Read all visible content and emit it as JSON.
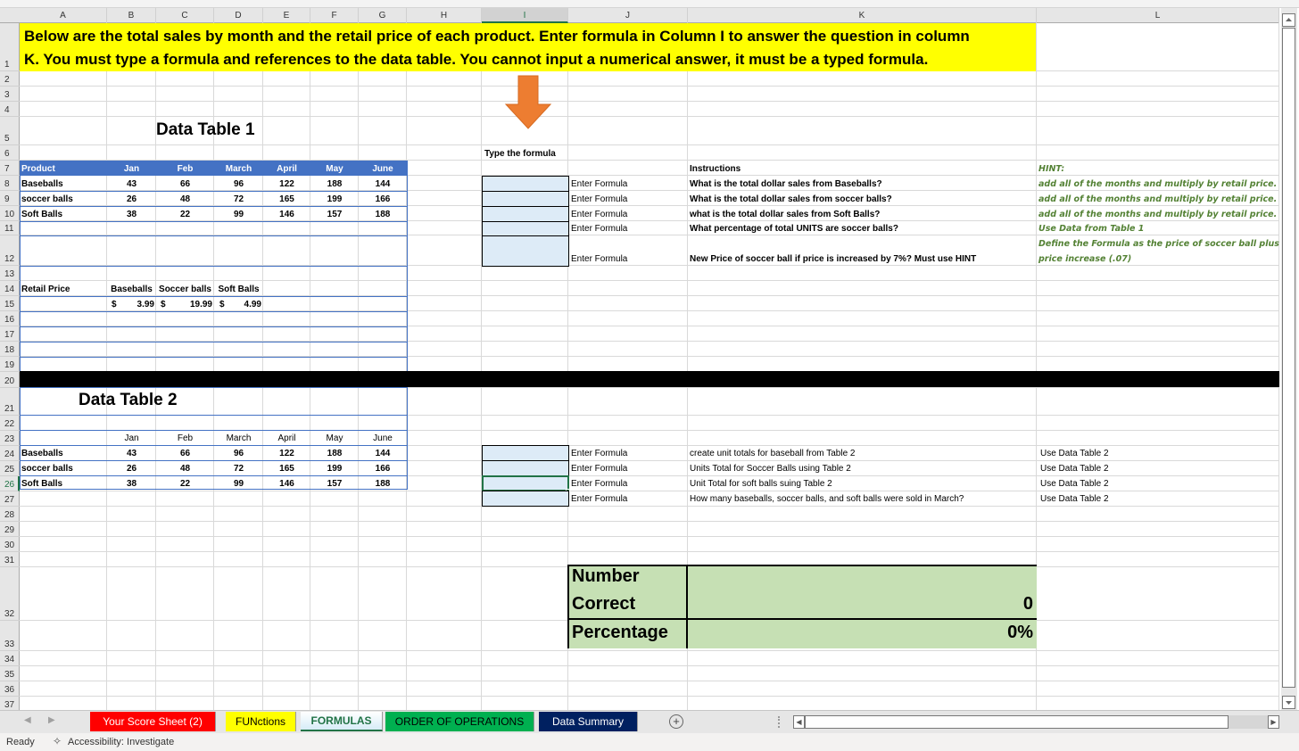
{
  "app": {
    "name": "Excel"
  },
  "columns": [
    "A",
    "B",
    "C",
    "D",
    "E",
    "F",
    "G",
    "H",
    "I",
    "J",
    "K",
    "L"
  ],
  "selected_column": "I",
  "rows": [
    "1",
    "2",
    "3",
    "4",
    "5",
    "6",
    "7",
    "8",
    "9",
    "10",
    "11",
    "12",
    "13",
    "14",
    "15",
    "16",
    "17",
    "18",
    "19",
    "20",
    "21",
    "22",
    "23",
    "24",
    "25",
    "26",
    "27",
    "28",
    "29",
    "30",
    "31",
    "32",
    "33",
    "34",
    "35",
    "36",
    "37"
  ],
  "selected_row": "26",
  "banner": {
    "line1": "Below are the total sales by month and the retail price of each product. Enter formula in Column I to answer the question in column",
    "line2": "K. You must type a formula and references to the data table. You cannot input a numerical answer, it must be a typed formula.",
    "color": "#ffff00"
  },
  "arrow": {
    "icon": "down-arrow-icon",
    "color": "#ed7d31"
  },
  "table1": {
    "title": "Data Table 1",
    "headers": [
      "Product",
      "Jan",
      "Feb",
      "March",
      "April",
      "May",
      "June"
    ],
    "rows": [
      [
        "Baseballs",
        "43",
        "66",
        "96",
        "122",
        "188",
        "144"
      ],
      [
        "soccer balls",
        "26",
        "48",
        "72",
        "165",
        "199",
        "166"
      ],
      [
        "Soft Balls",
        "38",
        "22",
        "99",
        "146",
        "157",
        "188"
      ]
    ],
    "header_color": "#4472c4"
  },
  "retail": {
    "label": "Retail Price",
    "headers": [
      "Baseballs",
      "Soccer balls",
      "Soft Balls"
    ],
    "currency": [
      "$",
      "$",
      "$"
    ],
    "values": [
      "3.99",
      "19.99",
      "4.99"
    ]
  },
  "table2": {
    "title": "Data Table 2",
    "headers": [
      "",
      "Jan",
      "Feb",
      "March",
      "April",
      "May",
      "June"
    ],
    "rows": [
      [
        "Baseballs",
        "43",
        "66",
        "96",
        "122",
        "188",
        "144"
      ],
      [
        "soccer balls",
        "26",
        "48",
        "72",
        "165",
        "199",
        "166"
      ],
      [
        "Soft Balls",
        "38",
        "22",
        "99",
        "146",
        "157",
        "188"
      ]
    ]
  },
  "questions1": {
    "type_label": "Type the formula",
    "instructions_header": "Instructions",
    "hint_header": "HINT:",
    "items": [
      {
        "input": "",
        "enter": "Enter Formula",
        "question": "What is the total dollar sales from Baseballs?",
        "hint": "add all of the months and multiply by retail price. Use"
      },
      {
        "input": "",
        "enter": "Enter Formula",
        "question": "What is the total dollar sales from soccer balls?",
        "hint": "add all of the months and multiply by retail price. Use"
      },
      {
        "input": "",
        "enter": "Enter Formula",
        "question": "what is the total   dollar sales from Soft Balls?",
        "hint": "add all of the months and multiply by retail price. Use"
      },
      {
        "input": "",
        "enter": "Enter Formula",
        "question": "What percentage of total UNITS are soccer balls?",
        "hint": "Use Data from Table 1"
      },
      {
        "input": "",
        "enter": "Enter Formula",
        "question": "New Price of soccer ball if price is increased by 7%? Must use HINT",
        "hint": "Define the Formula as the price of soccer ball plus price",
        "hint2": "price increase (.07)"
      }
    ],
    "hint_color": "#548235"
  },
  "questions2": {
    "items": [
      {
        "input": "",
        "enter": "Enter Formula",
        "question": "create unit totals for baseball  from Table 2",
        "hint": "Use Data Table 2"
      },
      {
        "input": "",
        "enter": "Enter Formula",
        "question": "Units Total for Soccer Balls using Table 2",
        "hint": "Use Data Table 2"
      },
      {
        "input": "",
        "enter": "Enter Formula",
        "question": "Unit Total for soft balls  suing Table 2",
        "hint": "Use Data Table 2"
      },
      {
        "input": "",
        "enter": "Enter Formula",
        "question": "How many baseballs, soccer balls, and soft balls were sold in March?",
        "hint": "Use Data Table 2"
      }
    ]
  },
  "score": {
    "number_label_1": "Number",
    "number_label_2": "Correct",
    "number_value": "0",
    "percentage_label": "Percentage",
    "percentage_value": "0%",
    "color": "#c6e0b4"
  },
  "sheet_tabs": [
    {
      "label": "Your Score Sheet (2)",
      "bg": "#ff0000",
      "fg": "#ffffff"
    },
    {
      "label": "FUNctions",
      "bg": "#ffff00",
      "fg": "#000000"
    },
    {
      "label": "FORMULAS",
      "bg": "#ffffff",
      "fg": "#217346",
      "active": true
    },
    {
      "label": "ORDER OF OPERATIONS",
      "bg": "#00b050",
      "fg": "#000000"
    },
    {
      "label": "Data Summary",
      "bg": "#002060",
      "fg": "#ffffff"
    }
  ],
  "add_sheet": "+",
  "status": {
    "ready": "Ready",
    "accessibility": "Accessibility: Investigate"
  }
}
